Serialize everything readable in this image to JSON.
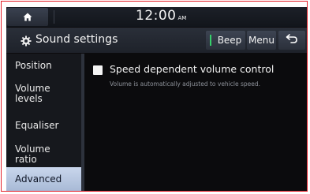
{
  "status_bar": {
    "time": "12:00",
    "ampm": "AM"
  },
  "title_bar": {
    "title": "Sound settings",
    "beep_label": "Beep",
    "menu_label": "Menu"
  },
  "sidebar": {
    "items": [
      {
        "label": "Position",
        "active": false
      },
      {
        "label": "Volume levels",
        "active": false
      },
      {
        "label": "Equaliser",
        "active": false
      },
      {
        "label": "Volume ratio",
        "active": false
      },
      {
        "label": "Advanced",
        "active": true
      }
    ]
  },
  "advanced": {
    "option_label": "Speed dependent volume control",
    "option_description": "Volume is automatically adjusted to vehicle speed.",
    "option_checked": false
  },
  "colors": {
    "frame_border": "#e5202a",
    "active_item_bg": "#b8c7e1",
    "beep_indicator": "#36d06a"
  },
  "icons": [
    "home-icon",
    "gear-icon",
    "back-arrow-icon"
  ]
}
